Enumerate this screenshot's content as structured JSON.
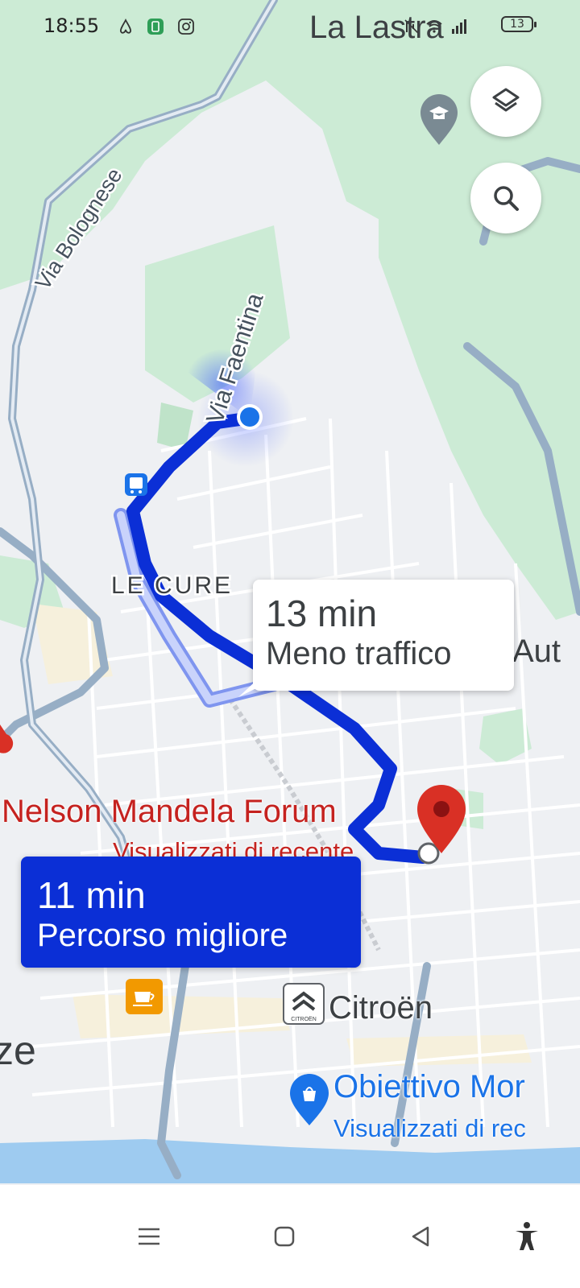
{
  "status_bar": {
    "time": "18:55",
    "battery": "13",
    "icons": [
      "airbnb-icon",
      "phone-app-icon",
      "instagram-icon",
      "mute-icon",
      "wifi-icon",
      "signal-icon"
    ]
  },
  "map": {
    "town_label": "La Lastra",
    "district_label": "LE CURE",
    "road_labels": [
      "Via Bolognese",
      "Via Faentina"
    ],
    "partial_labels": [
      "Aut",
      "ze"
    ],
    "colors": {
      "route_primary": "#0b2fd6",
      "route_alt": "#a9b8f5",
      "park": "#ccebd5",
      "water": "#9ecbf0",
      "poi_red": "#d93025",
      "poi_blue": "#1a73e8"
    }
  },
  "controls": {
    "layers_icon": "layers-icon",
    "search_icon": "search-icon"
  },
  "routes": {
    "alternative": {
      "time": "13 min",
      "label": "Meno traffico"
    },
    "best": {
      "time": "11 min",
      "label": "Percorso migliore"
    }
  },
  "places": {
    "destination": {
      "name": "Nelson Mandela Forum",
      "sub": "Visualizzati di recente"
    },
    "citroen": {
      "name": "Citroën",
      "logo_text": "CITROËN"
    },
    "obiettivo": {
      "name": "Obiettivo Mor",
      "sub": "Visualizzati di rec"
    }
  },
  "nav_bar": {
    "buttons": [
      "menu-icon",
      "home-icon",
      "back-icon",
      "accessibility-icon"
    ]
  }
}
